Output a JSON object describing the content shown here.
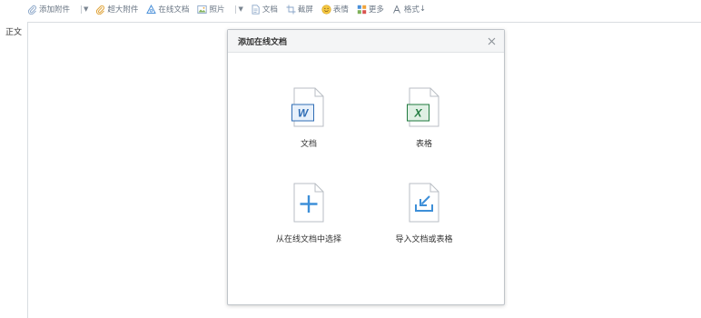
{
  "toolbar": {
    "items": [
      {
        "label": "添加附件",
        "icon": "paperclip-icon"
      },
      {
        "label": "超大附件",
        "icon": "large-attachment-icon"
      },
      {
        "label": "在线文档",
        "icon": "online-doc-icon"
      },
      {
        "label": "照片",
        "icon": "photo-icon"
      },
      {
        "label": "文档",
        "icon": "document-icon"
      },
      {
        "label": "截屏",
        "icon": "screenshot-icon"
      },
      {
        "label": "表情",
        "icon": "emoji-icon"
      },
      {
        "label": "更多",
        "icon": "more-icon"
      },
      {
        "label": "格式",
        "icon": "format-icon"
      }
    ],
    "format_suffix": "↓",
    "accent": "#8aa6c8"
  },
  "editor": {
    "body_label": "正文"
  },
  "dialog": {
    "title": "添加在线文档",
    "options": [
      {
        "label": "文档",
        "icon": "word-file-icon",
        "badge": "W",
        "color": "#2f6db5"
      },
      {
        "label": "表格",
        "icon": "excel-file-icon",
        "badge": "X",
        "color": "#1f7a3e"
      },
      {
        "label": "从在线文档中选择",
        "icon": "add-file-icon",
        "color": "#3d8fd8"
      },
      {
        "label": "导入文档或表格",
        "icon": "import-file-icon",
        "color": "#3d8fd8"
      }
    ]
  }
}
